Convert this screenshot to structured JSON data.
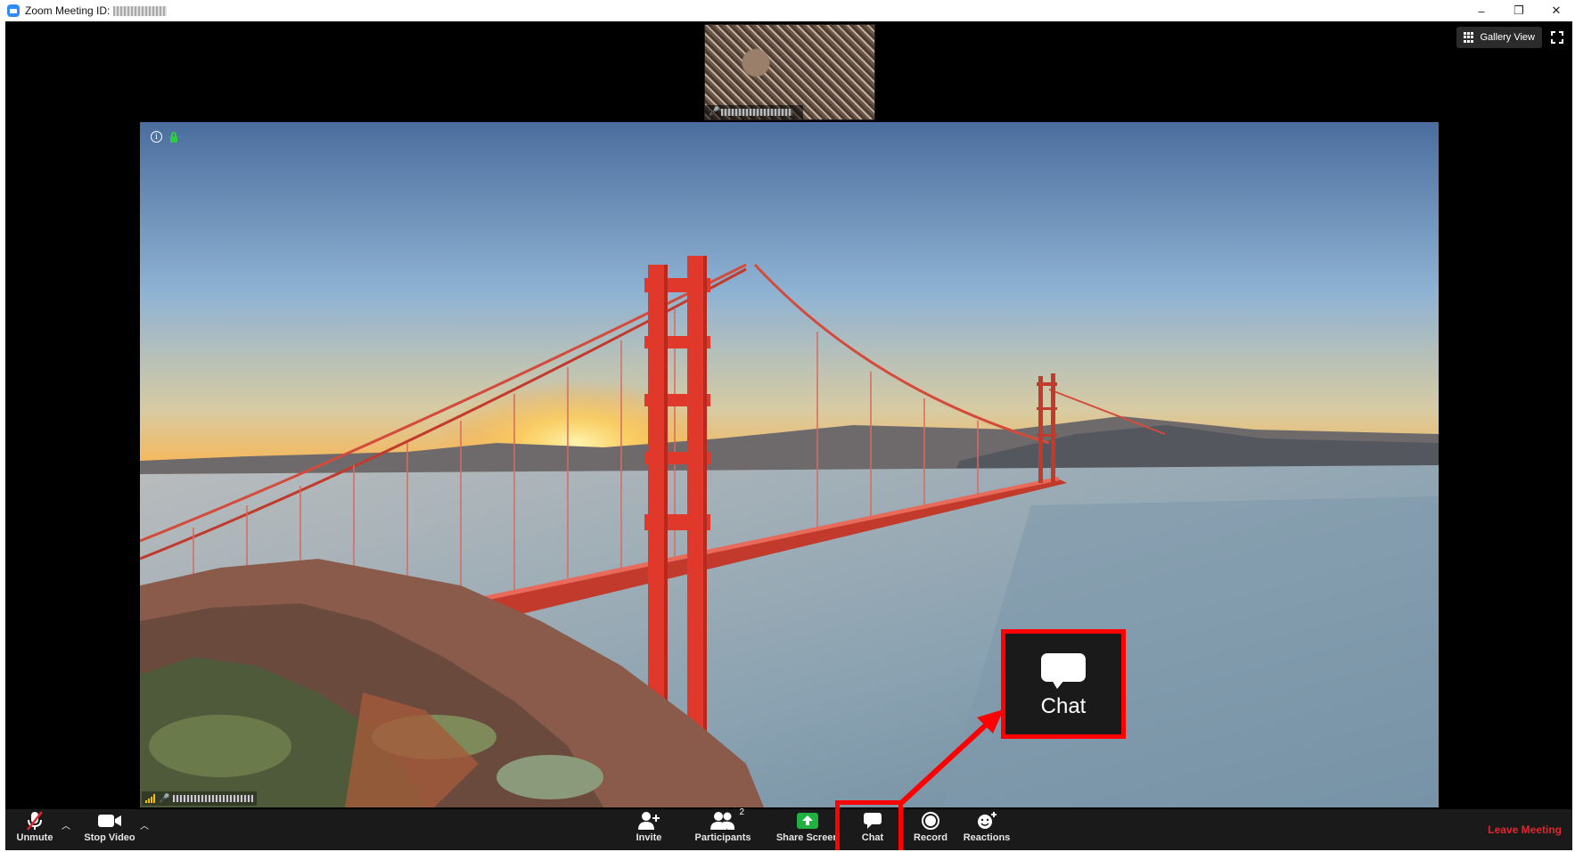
{
  "window": {
    "title": "Zoom Meeting ID:",
    "controls": {
      "minimize": "–",
      "restore": "❐",
      "close": "✕"
    }
  },
  "top_right": {
    "gallery_label": "Gallery View"
  },
  "callout": {
    "label": "Chat"
  },
  "toolbar": {
    "unmute": "Unmute",
    "stop_video": "Stop Video",
    "invite": "Invite",
    "participants": "Participants",
    "participants_count": "2",
    "share_screen": "Share Screen",
    "chat": "Chat",
    "record": "Record",
    "reactions": "Reactions",
    "leave": "Leave Meeting"
  },
  "colors": {
    "highlight": "#ff0000",
    "leave": "#e0252d",
    "share": "#1fb141",
    "toolbar_bg": "#1a1a1a"
  }
}
